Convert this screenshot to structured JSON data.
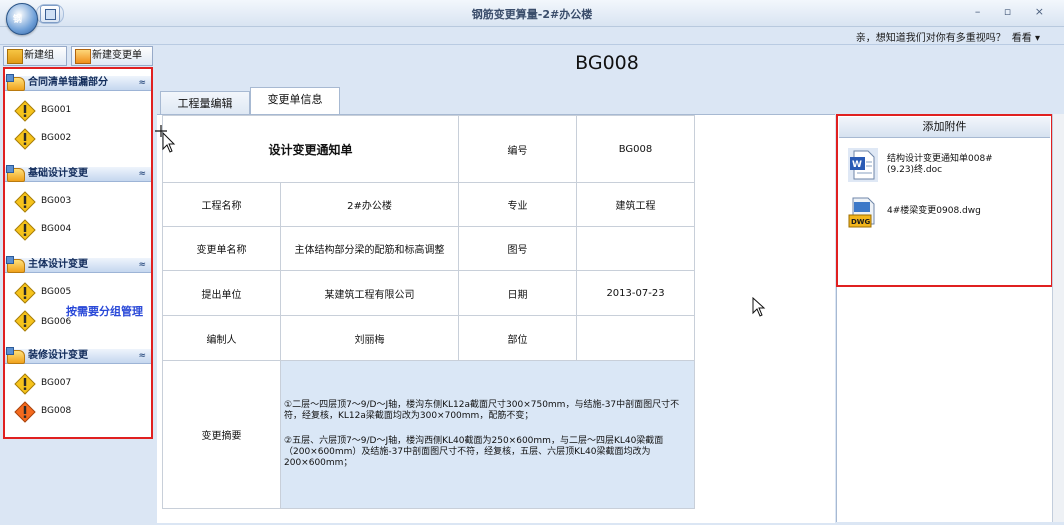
{
  "window": {
    "title": "钢筋变更算量-2#办公楼",
    "controls": "– ▫ ×",
    "app_badge": "钢"
  },
  "ribbon": {
    "feedback_text": "亲，想知道我们对你有多重视吗？",
    "feedback_link": "看看 ▾"
  },
  "toolbar": {
    "new_group": "新建组",
    "new_change": "新建变更单"
  },
  "sidebar": {
    "groups": [
      {
        "label": "合同清单错漏部分",
        "items": [
          "BG001",
          "BG002"
        ]
      },
      {
        "label": "基础设计变更",
        "items": [
          "BG003",
          "BG004"
        ]
      },
      {
        "label": "主体设计变更",
        "items": [
          "BG005",
          "BG006"
        ]
      },
      {
        "label": "装修设计变更",
        "items": [
          "BG007",
          "BG008"
        ]
      }
    ],
    "collapse_glyph": "≈",
    "annotation": "按需要分组管理"
  },
  "main": {
    "title": "BG008",
    "tabs": [
      "工程量编辑",
      "变更单信息"
    ],
    "active_tab": 1
  },
  "form": {
    "doc_title": "设计变更通知单",
    "labels": {
      "number": "编号",
      "project": "工程名称",
      "discipline": "专业",
      "change_name": "变更单名称",
      "drawing_no": "图号",
      "submitter": "提出单位",
      "date": "日期",
      "author": "编制人",
      "department": "部位",
      "summary": "变更摘要"
    },
    "values": {
      "number": "BG008",
      "project": "2#办公楼",
      "discipline": "建筑工程",
      "change_name": "主体结构部分梁的配筋和标高调整",
      "drawing_no": "",
      "submitter": "某建筑工程有限公司",
      "date": "2013-07-23",
      "author": "刘丽梅",
      "department": ""
    },
    "summary_p1": "①二层～四层顶7～9/D～J轴，楼沟东侧KL12a截面尺寸300×750mm，与结施-37中剖面图尺寸不符，经复核，KL12a梁截面均改为300×700mm，配筋不变；",
    "summary_p2": "②五层、六层顶7～9/D～J轴，楼沟西侧KL40截面为250×600mm，与二层～四层KL40梁截面（200×600mm）及结施-37中剖面图尺寸不符，经复核，五层、六层顶KL40梁截面均改为200×600mm；"
  },
  "attachments": {
    "header": "添加附件",
    "files": [
      {
        "name": "结构设计变更通知单008#(9.23)终.doc",
        "icon": "word-doc-icon"
      },
      {
        "name": "4#楼梁变更0908.dwg",
        "icon": "dwg-file-icon"
      }
    ]
  },
  "colors": {
    "highlight_border": "#e02020",
    "annotation_text": "#2a49d8",
    "summary_bg": "#dae7f6",
    "chrome_bg": "#dbe6f4"
  }
}
